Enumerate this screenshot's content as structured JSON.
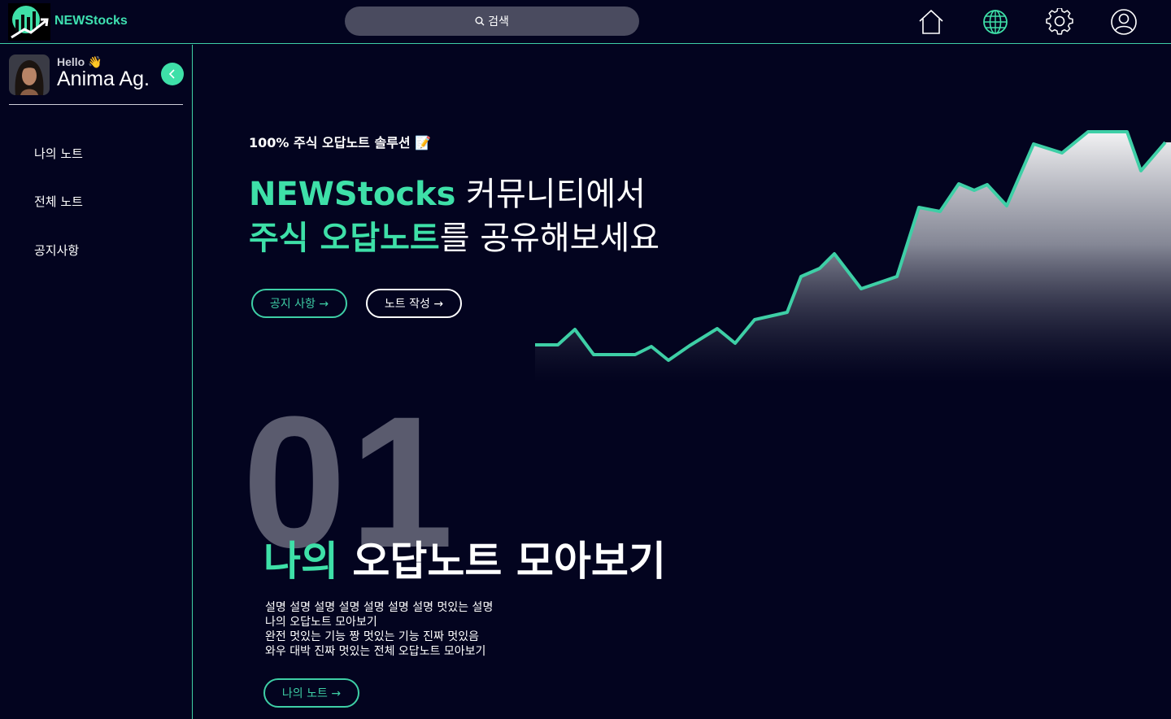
{
  "header": {
    "brand": "NEWStocks",
    "search_placeholder": "검색",
    "nav": [
      {
        "name": "home-icon"
      },
      {
        "name": "globe-icon"
      },
      {
        "name": "gear-icon"
      },
      {
        "name": "user-icon"
      }
    ]
  },
  "sidebar": {
    "greeting": "Hello 👋",
    "username": "Anima Ag.",
    "items": [
      {
        "label": "나의 노트"
      },
      {
        "label": "전체 노트"
      },
      {
        "label": "공지사항"
      }
    ]
  },
  "hero": {
    "tagline": "100% 주식 오답노트 솔루션 📝",
    "line1_accent": "NEWStocks",
    "line1_rest": " 커뮤니티에서",
    "line2_accent": "주식 오답노트",
    "line2_rest": "를 공유해보세요",
    "notice_button": "공지 사항 →",
    "write_button": "노트 작성 →"
  },
  "section": {
    "number": "01",
    "title_accent": "나의",
    "title_rest": " 오답노트 모아보기",
    "description": [
      "설명 설명 설명 설명 설명 설명 설명 멋있는 설명",
      "나의 오답노트 모아보기",
      "완전 멋있는 기능 짱 멋있는 기능 진짜 멋있음",
      "와우 대박 진짜 멋있는 전체 오답노트 모아보기"
    ],
    "button": "나의 노트 →"
  },
  "colors": {
    "background": "#03041f",
    "accent": "#3ee0a8",
    "divider": "#3ecfa6",
    "search_bg": "#4a4b5f",
    "big_number": "#5a5b6e"
  }
}
